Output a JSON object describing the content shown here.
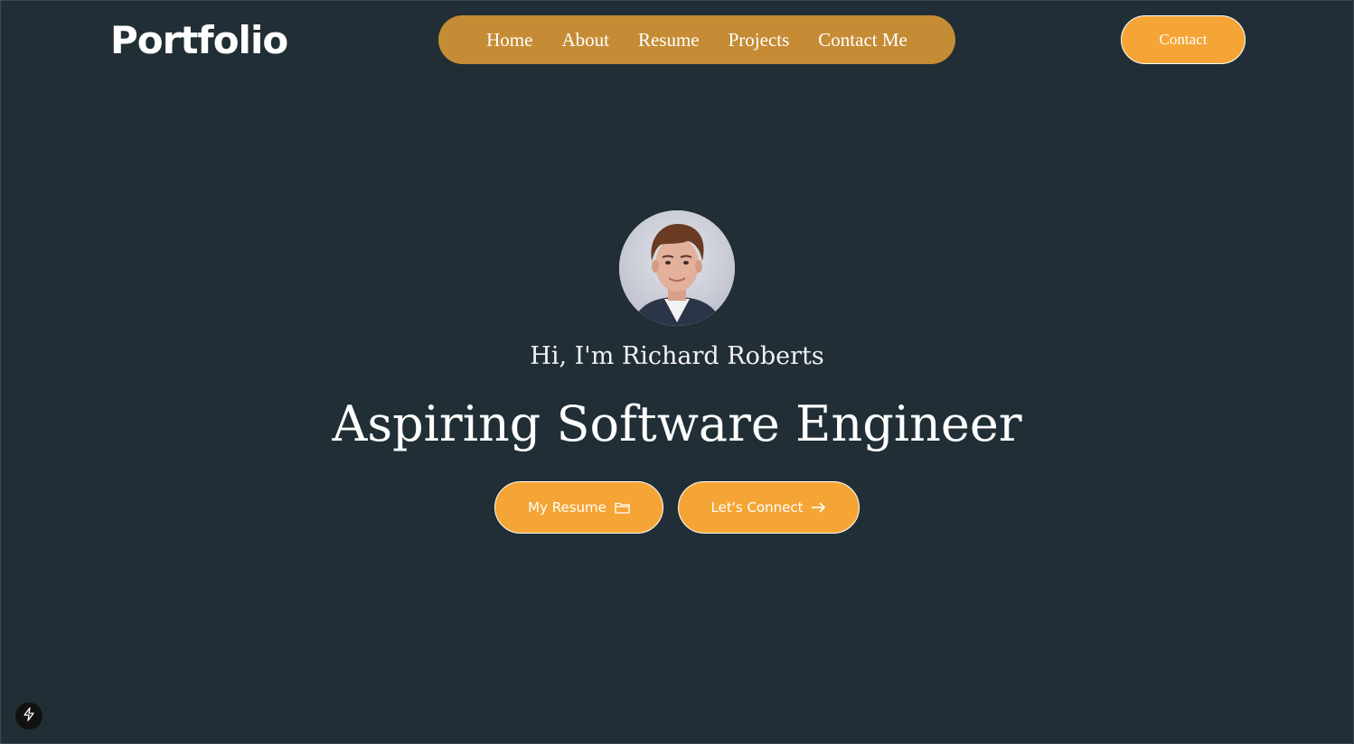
{
  "header": {
    "logo": "Portfolio",
    "nav": [
      "Home",
      "About",
      "Resume",
      "Projects",
      "Contact Me"
    ],
    "contact_label": "Contact"
  },
  "hero": {
    "avatar_icon": "profile-photo",
    "greeting": "Hi, I'm Richard Roberts",
    "headline": "Aspiring Software Engineer",
    "resume_button": {
      "label": "My Resume",
      "icon": "folder-icon"
    },
    "connect_button": {
      "label": "Let's Connect",
      "icon": "arrow-right-icon"
    }
  },
  "corner_badge": {
    "icon": "lightning-icon"
  },
  "colors": {
    "background": "#212e35",
    "nav_pill": "#c68c35",
    "accent": "#f5a535",
    "text": "#ffffff"
  }
}
